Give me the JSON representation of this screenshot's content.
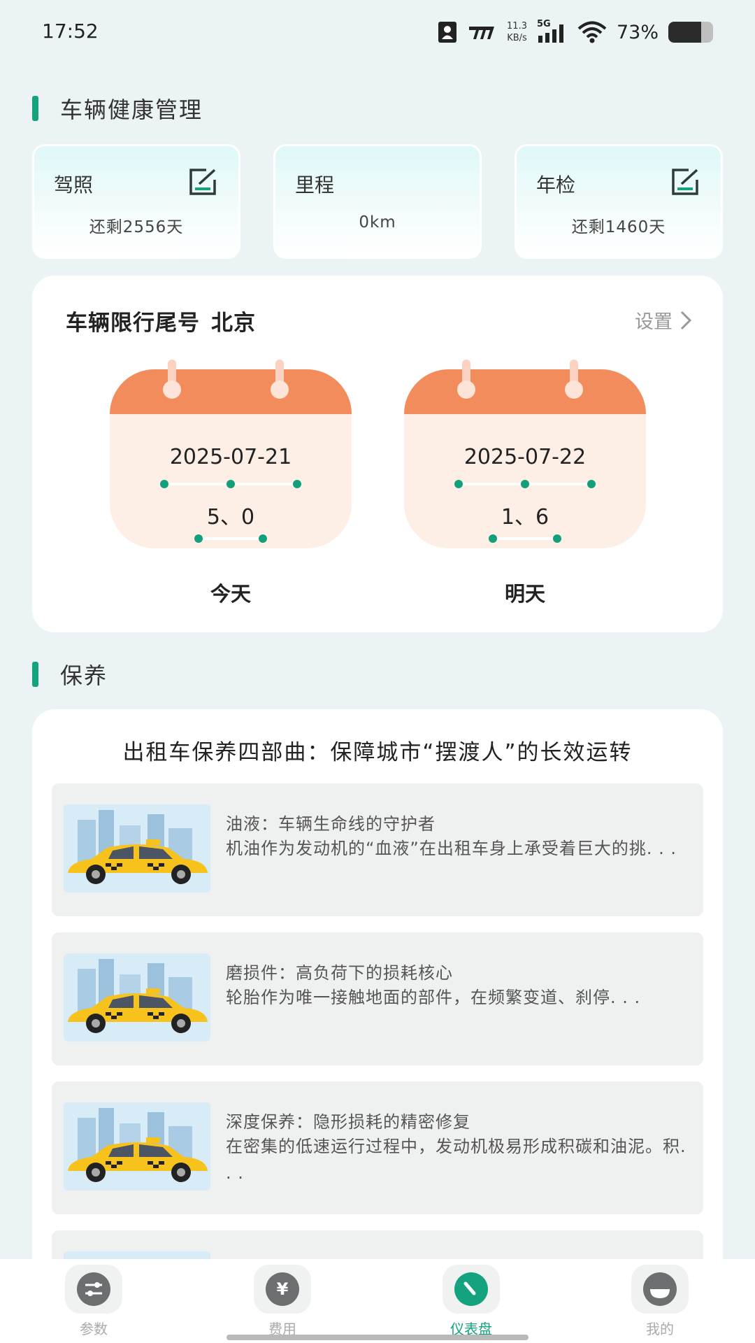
{
  "status_bar": {
    "time": "17:52",
    "net_speed_value": "11.3",
    "net_speed_unit": "KB/s",
    "network": "5G",
    "battery_percent": "73%",
    "battery_level": 0.73
  },
  "health": {
    "section_title": "车辆健康管理",
    "cards": [
      {
        "label": "驾照",
        "value": "还剩2556天",
        "editable": true
      },
      {
        "label": "里程",
        "value": "0km",
        "editable": false
      },
      {
        "label": "年检",
        "value": "还剩1460天",
        "editable": true
      }
    ]
  },
  "plate": {
    "title": "车辆限行尾号",
    "city": "北京",
    "setting_label": "设置",
    "days": [
      {
        "date": "2025-07-21",
        "numbers": "5、0",
        "label": "今天"
      },
      {
        "date": "2025-07-22",
        "numbers": "1、6",
        "label": "明天"
      }
    ]
  },
  "maintenance": {
    "section_title": "保养",
    "heading": "出租车保养四部曲：保障城市“摆渡人”的长效运转",
    "articles": [
      {
        "title": "油液：车辆生命线的守护者",
        "excerpt": "机油作为发动机的“血液”在出租车身上承受着巨大的挑. . ."
      },
      {
        "title": "磨损件：高负荷下的损耗核心",
        "excerpt": "轮胎作为唯一接触地面的部件，在频繁变道、刹停. . ."
      },
      {
        "title": "深度保养：隐形损耗的精密修复",
        "excerpt": "在密集的低速运行过程中，发动机极易形成积碳和油泥。积. . ."
      }
    ]
  },
  "nav": {
    "items": [
      {
        "label": "参数",
        "icon": "sliders-icon"
      },
      {
        "label": "费用",
        "icon": "yuan-icon"
      },
      {
        "label": "仪表盘",
        "icon": "gauge-icon",
        "active": true
      },
      {
        "label": "我的",
        "icon": "profile-icon"
      }
    ]
  },
  "colors": {
    "accent": "#15a37f",
    "calendar_head": "#f28c5c",
    "calendar_body": "#fdeee6",
    "background": "#ecf3f4"
  }
}
